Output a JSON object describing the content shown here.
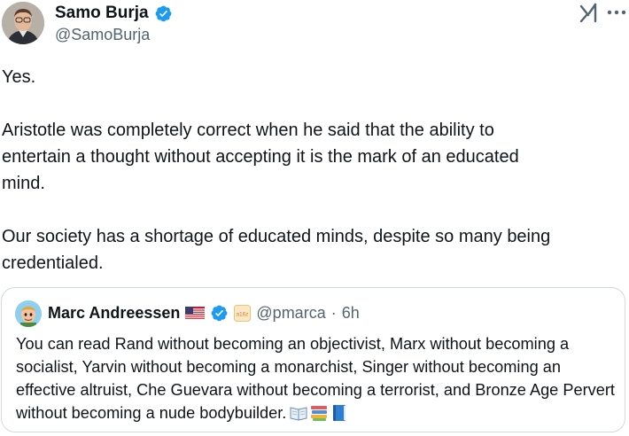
{
  "author": {
    "name": "Samo Burja",
    "handle": "@SamoBurja"
  },
  "tweet": {
    "paragraphs": [
      "Yes.",
      "Aristotle was completely correct when he said that the ability to\nentertain a thought without accepting it is the mark of an educated\nmind.",
      "Our society has a shortage of educated minds, despite so many being\ncredentialed."
    ]
  },
  "quote": {
    "name": "Marc Andreessen",
    "handle": "@pmarca",
    "separator": "·",
    "time": "6h",
    "affiliate_badge": "a16z",
    "text": "You can read Rand without becoming an objectivist, Marx without becoming a socialist, Yarvin without becoming a monarchist, Singer without becoming an effective altruist, Che Guevara without becoming a terrorist, and Bronze Age Pervert without becoming a nude bodybuilder.",
    "emojis": [
      "open-book-icon",
      "books-icon",
      "blue-book-icon"
    ]
  },
  "colors": {
    "text_primary": "#0f1419",
    "text_secondary": "#536471",
    "verified_blue": "#1d9bf0",
    "border": "#cfd9de"
  },
  "icons": {
    "verified": "verified-badge-icon",
    "grok": "grok-icon",
    "more": "more-options-icon",
    "flag": "us-flag-icon"
  }
}
